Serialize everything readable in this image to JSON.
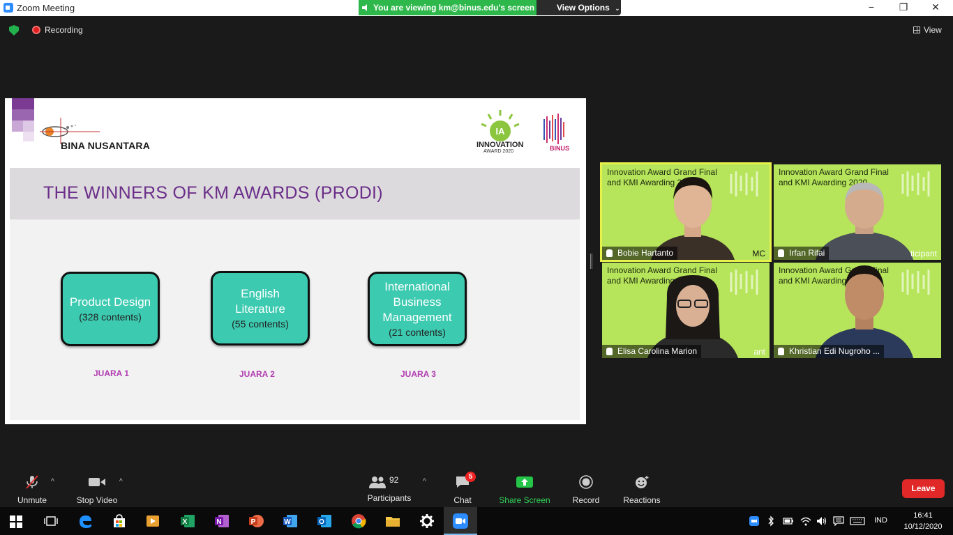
{
  "window": {
    "title": "Zoom Meeting",
    "share_banner": "You are viewing km@binus.edu's screen",
    "view_options": "View Options",
    "minimize": "−",
    "maximize": "❐",
    "close": "✕"
  },
  "status": {
    "recording": "Recording",
    "view": "View"
  },
  "slide": {
    "org_name": "BINA NUSANTARA",
    "innovation_logo_text": "INNOVATION",
    "innovation_logo_year": "AWARD 2020",
    "binus_logo_text": "BINUS",
    "title": "THE WINNERS OF KM AWARDS (PRODI)",
    "awards": [
      {
        "name": "Product Design",
        "count": "(328 contents)",
        "rank": "JUARA 1"
      },
      {
        "name": "English Literature",
        "count": "(55 contents)",
        "rank": "JUARA 2"
      },
      {
        "name": "International Business Management",
        "count": "(21 contents)",
        "rank": "JUARA 3"
      }
    ]
  },
  "participants_video": [
    {
      "caption": "Innovation Award Grand Final and KMI Awarding 2020",
      "name": "Bobie Hartanto",
      "role": "MC"
    },
    {
      "caption": "Innovation Award Grand Final and KMI Awarding 2020",
      "name": "Irfan Rifai",
      "role": "ticipant"
    },
    {
      "caption": "Innovation Award Grand Final and KMI Awarding 2020",
      "name": "Elisa Carolina Marion",
      "role": "ant"
    },
    {
      "caption": "Innovation Award Grand Final and KMI Awarding 2020",
      "name": "Khristian Edi Nugroho ...",
      "role": ""
    }
  ],
  "toolbar": {
    "unmute": "Unmute",
    "stop_video": "Stop Video",
    "participants": "Participants",
    "participants_count": "92",
    "chat": "Chat",
    "chat_badge": "5",
    "share_screen": "Share Screen",
    "record": "Record",
    "reactions": "Reactions",
    "leave": "Leave",
    "caret": "^"
  },
  "taskbar": {
    "language": "IND",
    "time": "16:41",
    "date": "10/12/2020"
  },
  "colors": {
    "accent_green": "#2eb84b",
    "zoom_blue": "#2d8cff",
    "leave_red": "#e02828",
    "award_teal": "#3ccab0",
    "title_purple": "#6b2e8a"
  }
}
